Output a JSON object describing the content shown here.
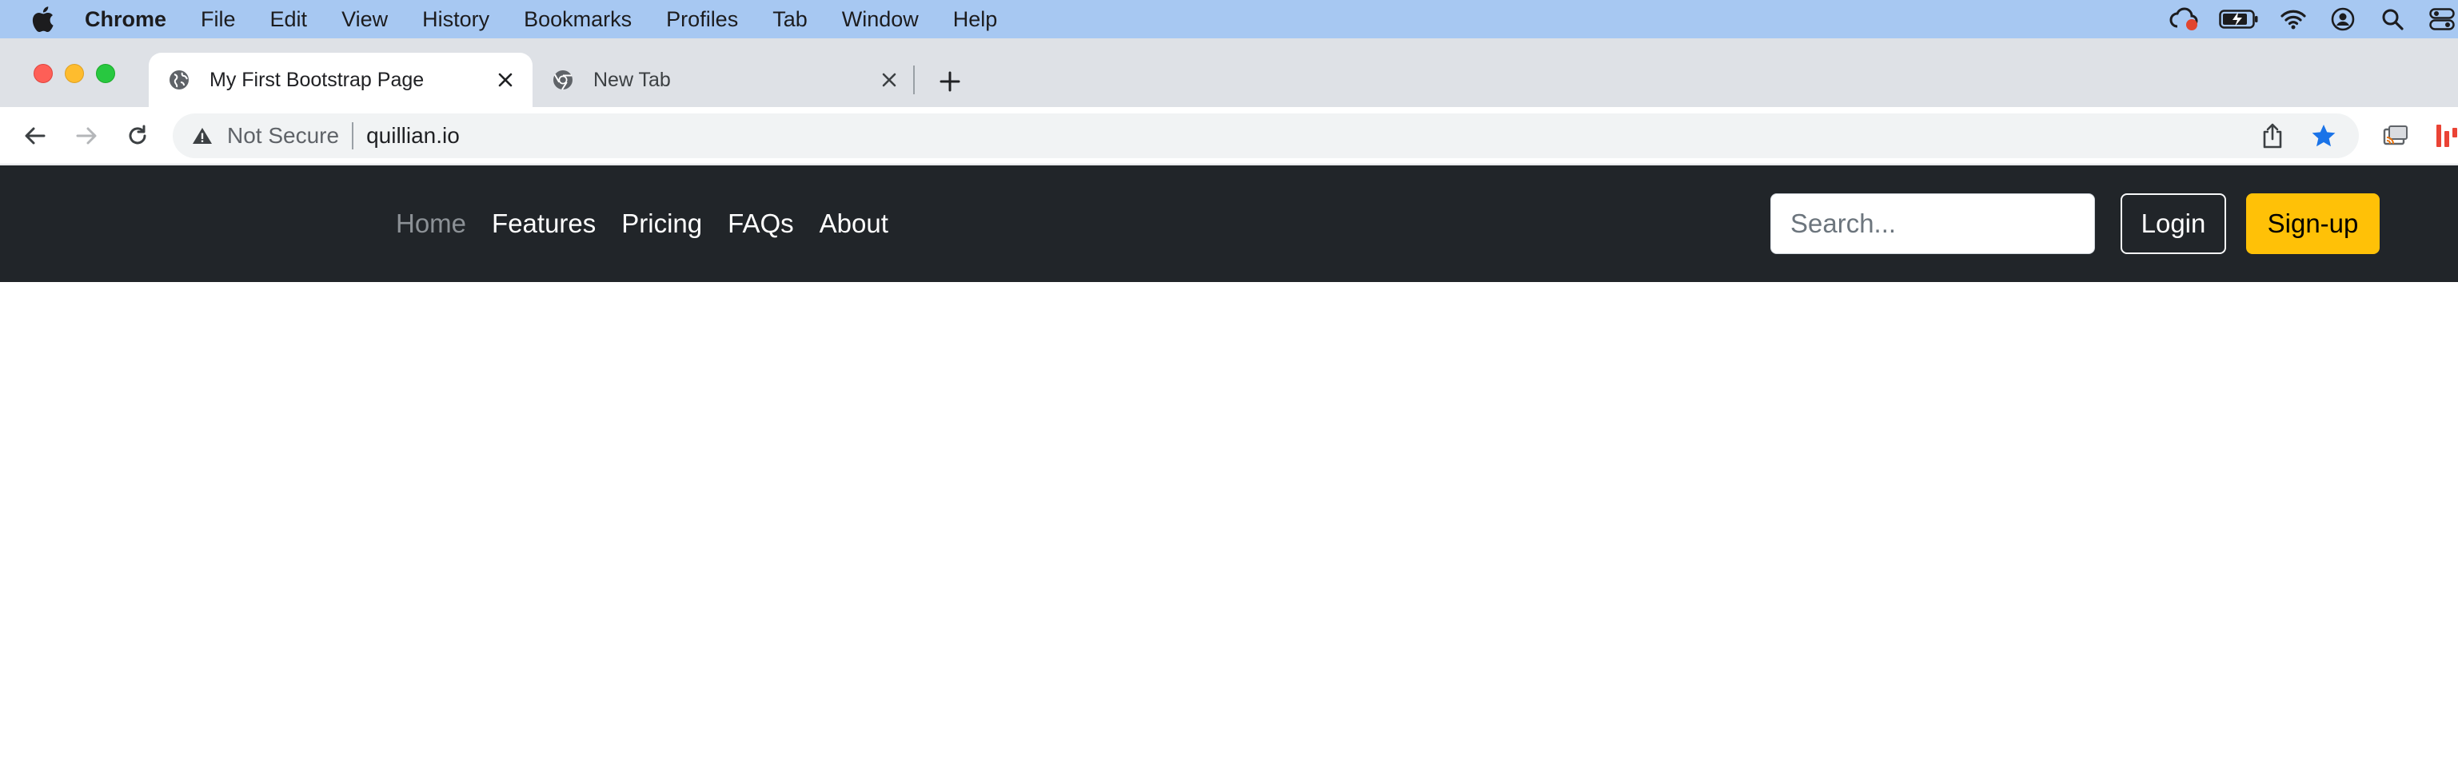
{
  "menubar": {
    "apple_icon": "apple-logo-icon",
    "app_name": "Chrome",
    "items": [
      "File",
      "Edit",
      "View",
      "History",
      "Bookmarks",
      "Profiles",
      "Tab",
      "Window",
      "Help"
    ],
    "status_icons": [
      "creative-cloud-icon",
      "battery-charging-icon",
      "wifi-icon",
      "user-account-icon",
      "spotlight-search-icon",
      "control-center-icon"
    ]
  },
  "tabs": [
    {
      "title": "My First Bootstrap Page",
      "icon": "globe-icon",
      "active": true
    },
    {
      "title": "New Tab",
      "icon": "chrome-icon",
      "active": false
    }
  ],
  "toolbar": {
    "security_label": "Not Secure",
    "url": "quillian.io",
    "icons": [
      "back-arrow-icon",
      "forward-arrow-icon",
      "reload-icon",
      "warning-icon",
      "share-icon",
      "bookmark-star-icon",
      "cast-icon",
      "extension-icon"
    ]
  },
  "site": {
    "nav_links": [
      "Home",
      "Features",
      "Pricing",
      "FAQs",
      "About"
    ],
    "search_placeholder": "Search...",
    "login_label": "Login",
    "signup_label": "Sign-up",
    "colors": {
      "navbar_bg": "#212529",
      "signup_bg": "#ffc107",
      "active_link": "#8c9196"
    }
  }
}
